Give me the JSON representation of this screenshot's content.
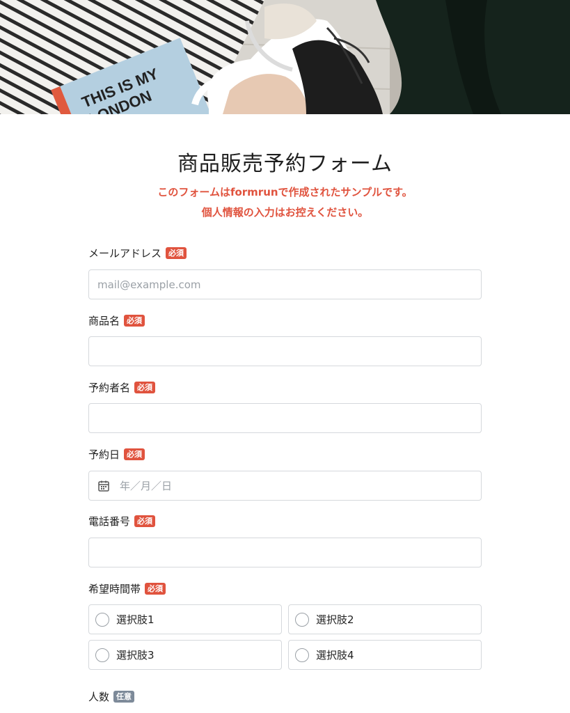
{
  "header": {
    "book_text_line1": "THIS IS MY",
    "book_text_line2": "LONDON"
  },
  "form": {
    "title": "商品販売予約フォーム",
    "notice_line1": "このフォームはformrunで作成されたサンプルです。",
    "notice_line2": "個人情報の入力はお控えください。",
    "required_label": "必須",
    "optional_label": "任意",
    "fields": {
      "email": {
        "label": "メールアドレス",
        "placeholder": "mail@example.com"
      },
      "product": {
        "label": "商品名"
      },
      "name": {
        "label": "予約者名"
      },
      "date": {
        "label": "予約日",
        "placeholder": "年／月／日"
      },
      "phone": {
        "label": "電話番号"
      },
      "timeslot": {
        "label": "希望時間帯",
        "options": [
          "選択肢1",
          "選択肢2",
          "選択肢3",
          "選択肢4"
        ]
      },
      "people": {
        "label": "人数"
      }
    }
  },
  "colors": {
    "accent": "#e0533e",
    "optional_badge": "#7d8a99",
    "border": "#d5d8dc"
  }
}
